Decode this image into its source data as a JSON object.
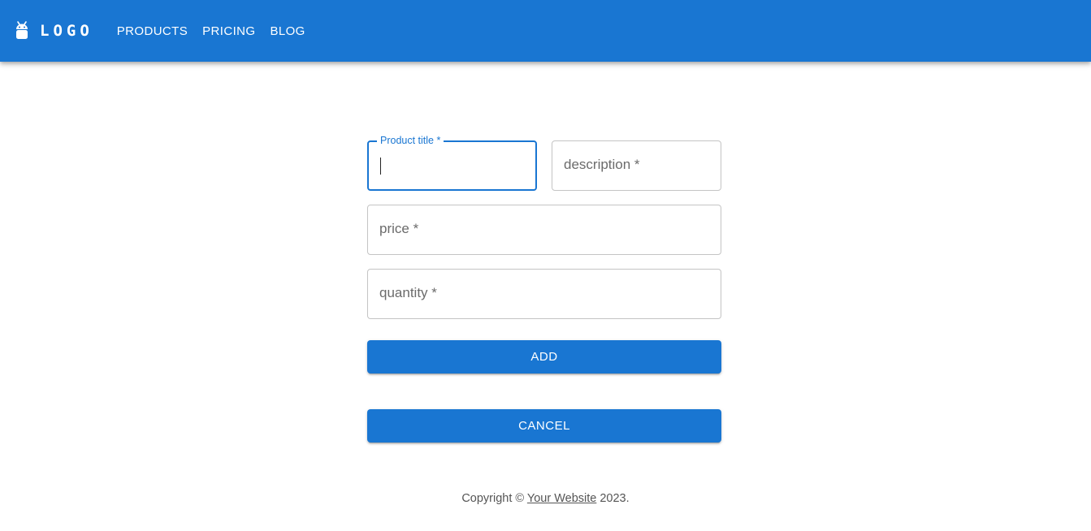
{
  "header": {
    "logo_icon": "android-icon",
    "logo_text": "LOGO",
    "nav": [
      "PRODUCTS",
      "PRICING",
      "BLOG"
    ],
    "accent_color": "#1976d2"
  },
  "form": {
    "title_field": {
      "label": "Product title *",
      "value": ""
    },
    "description_field": {
      "placeholder": "description *"
    },
    "price_field": {
      "placeholder": "price *"
    },
    "quantity_field": {
      "placeholder": "quantity *"
    },
    "add_label": "ADD",
    "cancel_label": "CANCEL"
  },
  "footer": {
    "prefix": "Copyright © ",
    "link": "Your Website",
    "suffix": " 2023."
  }
}
